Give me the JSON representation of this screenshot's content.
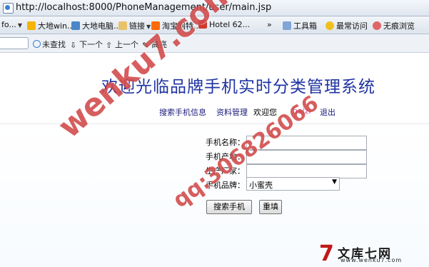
{
  "browser": {
    "url": "http://localhost:8000/PhoneManagement/user/main.jsp",
    "favorites": [
      {
        "label": "fo...",
        "icon": "folder-icon"
      },
      {
        "label": "大地win...",
        "icon": "page-icon"
      },
      {
        "label": "大地电脑...",
        "icon": "page-icon"
      },
      {
        "label": "链接",
        "icon": "folder-icon"
      },
      {
        "label": "淘宝网特...",
        "icon": "taobao-icon"
      },
      {
        "label": "Hotel 62...",
        "icon": "page-icon"
      },
      {
        "label": "工具箱",
        "icon": "toolbox-icon"
      },
      {
        "label": "最常访问",
        "icon": "star-icon"
      },
      {
        "label": "无痕浏览",
        "icon": "incognito-icon"
      }
    ],
    "find": {
      "not_found": "未查找",
      "next": "下一个",
      "prev": "上一个",
      "highlight": "高亮"
    }
  },
  "page": {
    "title": "欢迎光临品牌手机实时分类管理系统",
    "nav": {
      "search": "搜索手机信息",
      "profile": "资料管理",
      "welcome": "欢迎您",
      "username": "baizi",
      "logout": "退出"
    },
    "form": {
      "name_label": "手机名称：",
      "origin_label": "手机产地：",
      "maker_label": "生产厂家：",
      "brand_label": "手机品牌：",
      "name_value": "",
      "origin_value": "",
      "maker_value": "",
      "brand_selected": "小蜜壳",
      "search_button": "搜索手机",
      "reset_button": "重填"
    }
  },
  "watermarks": {
    "site": "wenku7.com",
    "qq": "qq:306826066",
    "logo_cn": "文库七网",
    "logo_url": "www.wenku7.com"
  },
  "colors": {
    "title": "#1f33a3",
    "link": "#1a1a7c",
    "watermark": "#c82828"
  }
}
